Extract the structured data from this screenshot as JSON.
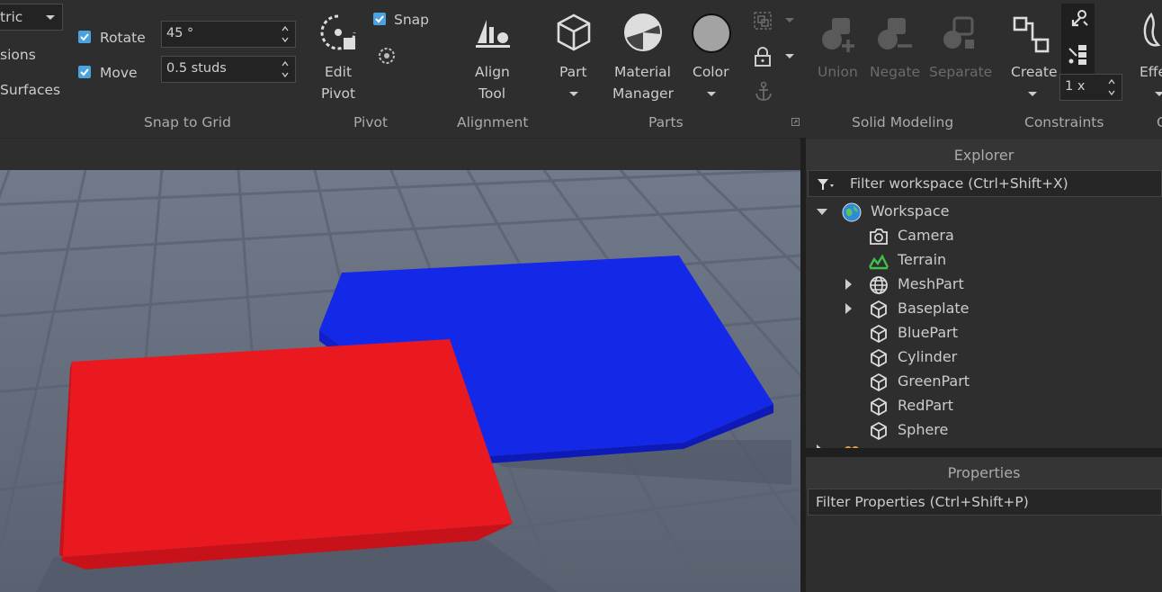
{
  "ribbon": {
    "partial_dropdown_value": "tric",
    "partial_items": [
      "sions",
      "Surfaces"
    ],
    "snap_to_grid": {
      "rotate": {
        "label": "Rotate",
        "checked": true,
        "value": "45 °"
      },
      "move": {
        "label": "Move",
        "checked": true,
        "value": "0.5 studs"
      },
      "group_label": "Snap to Grid"
    },
    "pivot": {
      "edit_pivot_label": "Edit\nPivot",
      "edit_pivot_l1": "Edit",
      "edit_pivot_l2": "Pivot",
      "snap_label": "Snap",
      "snap_checked": true,
      "group_label": "Pivot"
    },
    "alignment": {
      "align_tool_l1": "Align",
      "align_tool_l2": "Tool",
      "group_label": "Alignment"
    },
    "parts": {
      "part_label": "Part",
      "material_l1": "Material",
      "material_l2": "Manager",
      "color_label": "Color",
      "group_label": "Parts"
    },
    "solid_modeling": {
      "union_label": "Union",
      "negate_label": "Negate",
      "separate_label": "Separate",
      "group_label": "Solid Modeling"
    },
    "constraints": {
      "create_label": "Create",
      "scale_value": "1 x",
      "group_label": "Constraints"
    },
    "effects_partial": "Effe",
    "next_group_partial": "C"
  },
  "explorer": {
    "title": "Explorer",
    "filter_placeholder": "Filter workspace (Ctrl+Shift+X)",
    "tree": [
      {
        "name": "Workspace",
        "icon": "workspace-globe-icon",
        "expanded": true,
        "level": 0
      },
      {
        "name": "Camera",
        "icon": "camera-icon",
        "level": 1
      },
      {
        "name": "Terrain",
        "icon": "terrain-icon",
        "level": 1
      },
      {
        "name": "MeshPart",
        "icon": "meshpart-icon",
        "level": 1,
        "collapsed": true
      },
      {
        "name": "Baseplate",
        "icon": "part-cube-icon",
        "level": 1,
        "collapsed": true
      },
      {
        "name": "BluePart",
        "icon": "part-cube-icon",
        "level": 1
      },
      {
        "name": "Cylinder",
        "icon": "part-cube-icon",
        "level": 1
      },
      {
        "name": "GreenPart",
        "icon": "part-cube-icon",
        "level": 1
      },
      {
        "name": "RedPart",
        "icon": "part-cube-icon",
        "level": 1
      },
      {
        "name": "Sphere",
        "icon": "part-cube-icon",
        "level": 1
      }
    ]
  },
  "properties": {
    "title": "Properties",
    "filter_placeholder": "Filter Properties (Ctrl+Shift+P)"
  },
  "colors": {
    "accent": "#4aa3df",
    "red_part": "#e8141e",
    "blue_part": "#1428e8",
    "terrain": "#3fc24a"
  }
}
